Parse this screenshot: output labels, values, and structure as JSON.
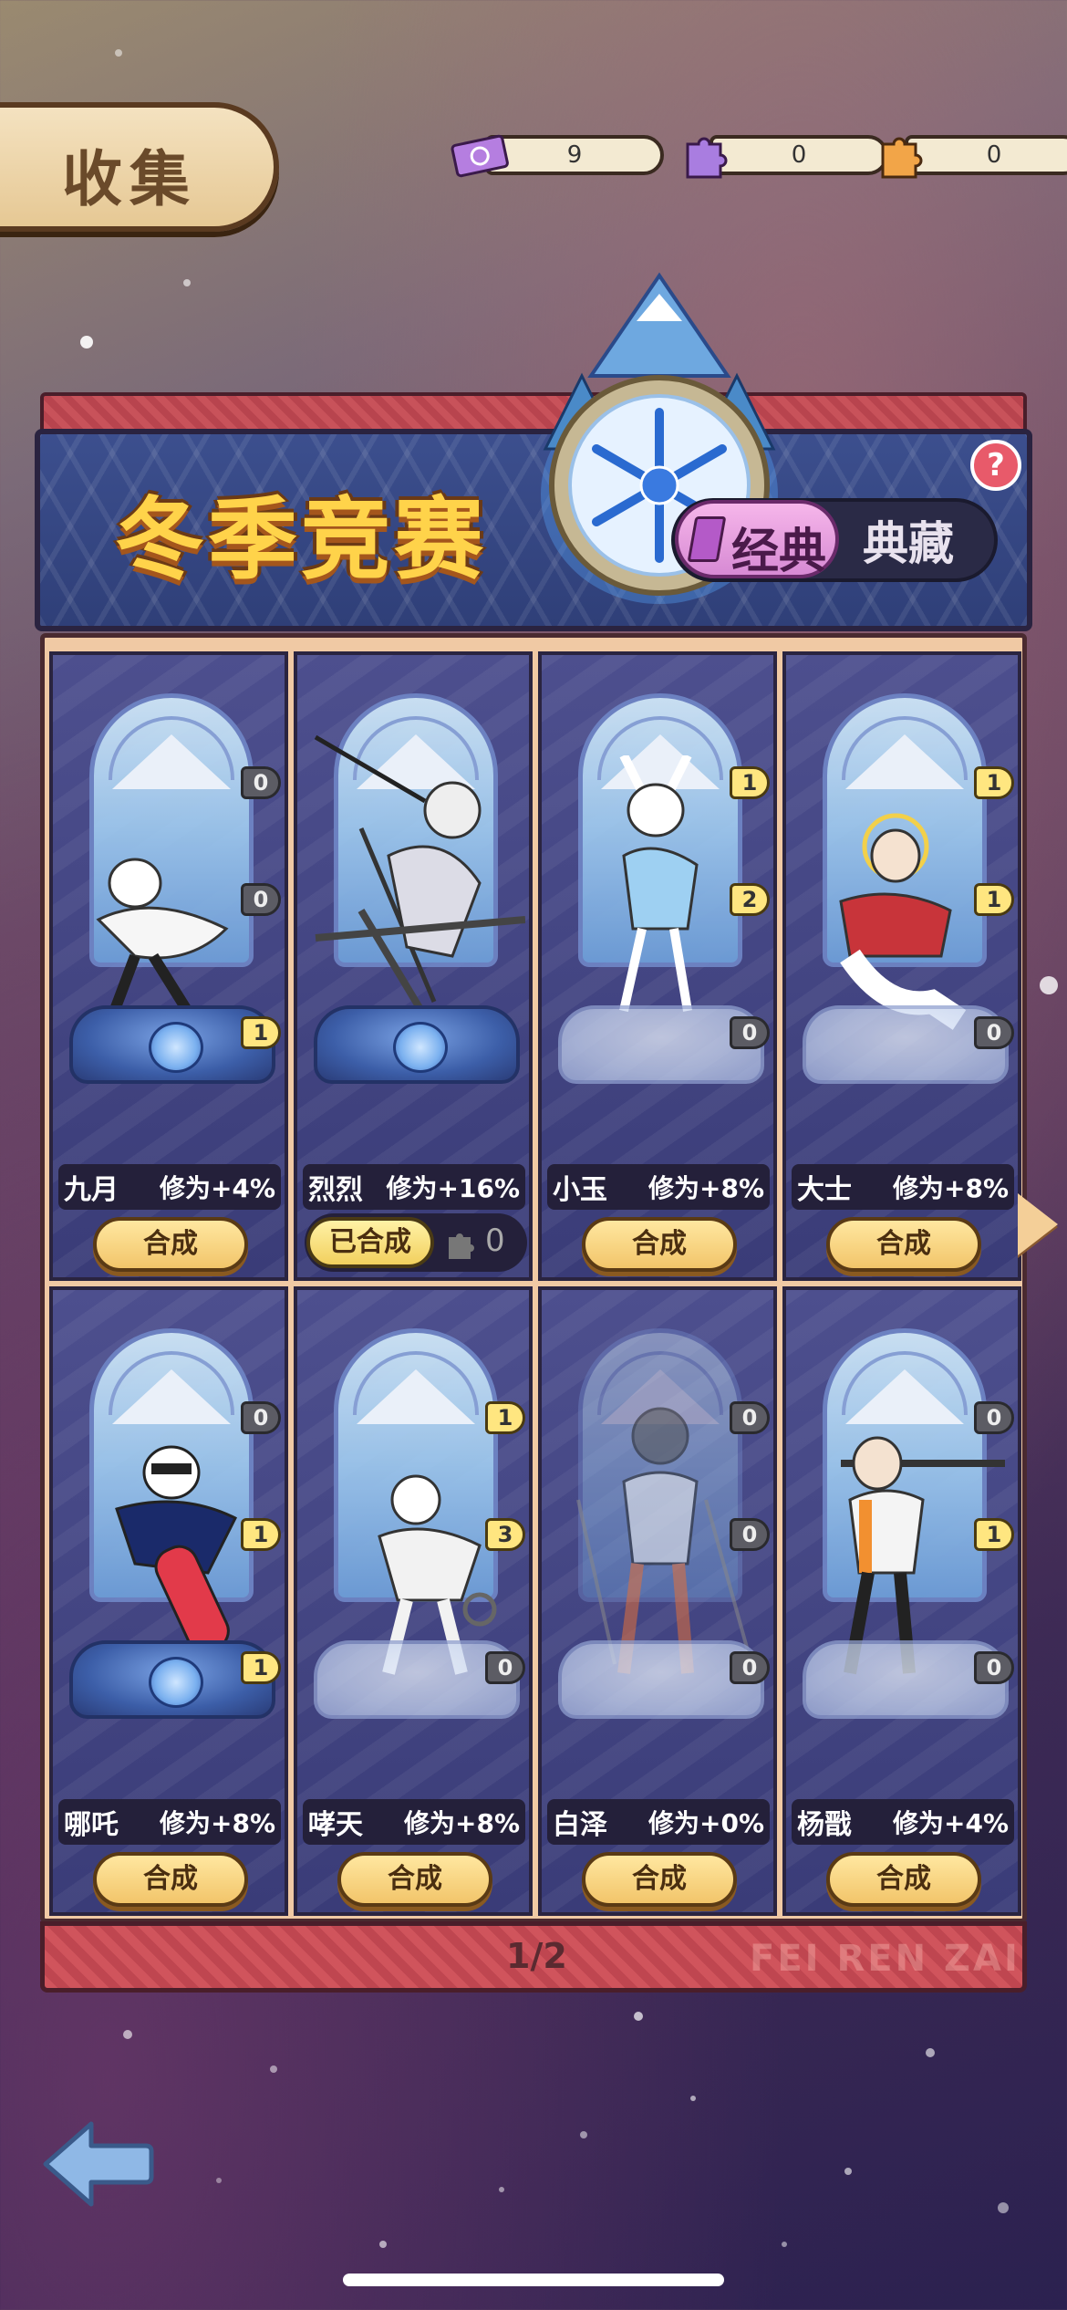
{
  "header": {
    "title": "收集"
  },
  "currencies": [
    {
      "icon": "ticket-icon",
      "value": "9"
    },
    {
      "icon": "purple-puzzle-icon",
      "value": "0"
    },
    {
      "icon": "orange-puzzle-icon",
      "value": "0"
    }
  ],
  "banner": {
    "title": "冬季竞赛",
    "help": "?",
    "tabs": {
      "active": "经典",
      "inactive": "典藏"
    }
  },
  "cards": [
    {
      "name": "九月",
      "bonus": "修为+4%",
      "button": "合成",
      "badges": [
        "0",
        "0",
        "1"
      ]
    },
    {
      "name": "烈烈",
      "bonus": "修为+16%",
      "button": "已合成",
      "puzzle_count": "0",
      "badges": []
    },
    {
      "name": "小玉",
      "bonus": "修为+8%",
      "button": "合成",
      "badges": [
        "1",
        "2",
        "0"
      ]
    },
    {
      "name": "大士",
      "bonus": "修为+8%",
      "button": "合成",
      "badges": [
        "1",
        "1",
        "0"
      ]
    },
    {
      "name": "哪吒",
      "bonus": "修为+8%",
      "button": "合成",
      "badges": [
        "0",
        "1",
        "1"
      ]
    },
    {
      "name": "哮天",
      "bonus": "修为+8%",
      "button": "合成",
      "badges": [
        "1",
        "3",
        "0"
      ]
    },
    {
      "name": "白泽",
      "bonus": "修为+0%",
      "button": "合成",
      "badges": [
        "0",
        "0",
        "0"
      ]
    },
    {
      "name": "杨戬",
      "bonus": "修为+4%",
      "button": "合成",
      "badges": [
        "0",
        "1",
        "0"
      ]
    }
  ],
  "pagination": {
    "label": "1/2"
  },
  "watermark": "FEI REN ZAI",
  "colors": {
    "accent": "#ffd34a",
    "panel": "#3a3c78",
    "button": "#f2c56a"
  }
}
